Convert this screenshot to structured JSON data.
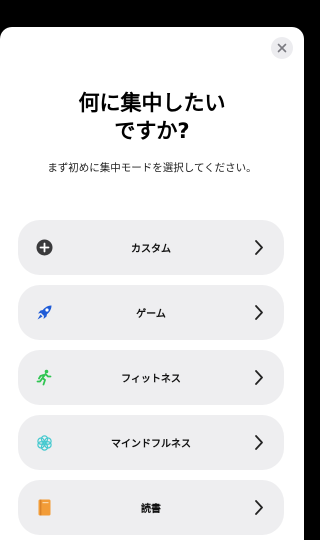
{
  "title": {
    "line1": "何に集中したい",
    "line2": "ですか?"
  },
  "subtitle": "まず初めに集中モードを選択してください。",
  "items": [
    {
      "label": "カスタム",
      "icon": "plus-circle-icon",
      "color": "#3a3a3c"
    },
    {
      "label": "ゲーム",
      "icon": "rocket-icon",
      "color": "#1e5bd7"
    },
    {
      "label": "フィットネス",
      "icon": "running-icon",
      "color": "#30c552"
    },
    {
      "label": "マインドフルネス",
      "icon": "flower-icon",
      "color": "#45c9cf"
    },
    {
      "label": "読書",
      "icon": "book-icon",
      "color": "#f29c38"
    }
  ]
}
